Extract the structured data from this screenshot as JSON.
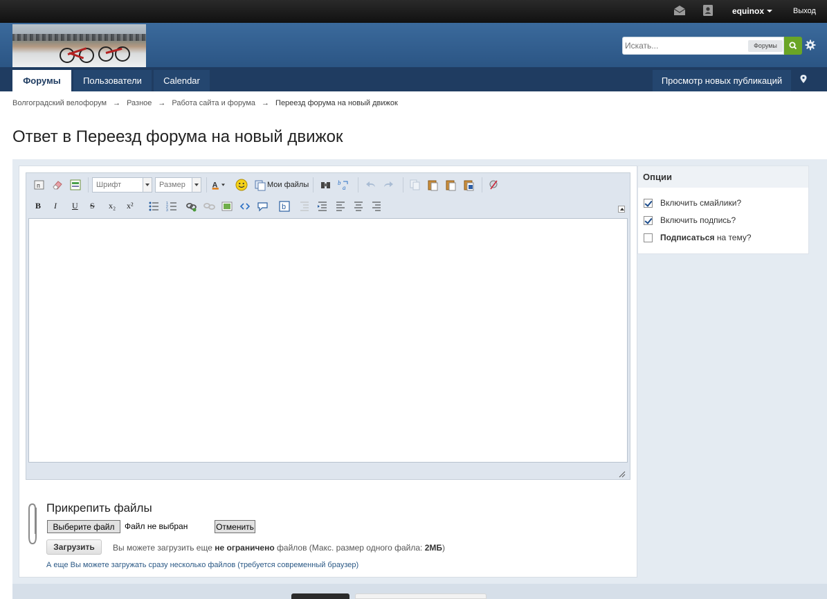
{
  "userbar": {
    "username": "equinox",
    "logout": "Выход",
    "icons": [
      "envelope-icon",
      "user-card-icon",
      "chevron-down-icon"
    ]
  },
  "header": {
    "search_placeholder": "Искать...",
    "search_scope": "Форумы",
    "icons": [
      "search-icon",
      "gear-icon"
    ]
  },
  "nav": {
    "tabs": [
      {
        "label": "Форумы",
        "active": true
      },
      {
        "label": "Пользователи",
        "active": false
      },
      {
        "label": "Calendar",
        "active": false
      }
    ],
    "new_posts": "Просмотр новых публикаций",
    "icons": [
      "map-pin-icon"
    ]
  },
  "breadcrumb": {
    "items": [
      "Волгоградский велофорум",
      "Разное",
      "Работа сайта и форума",
      "Переезд форума на новый движок"
    ],
    "separator": "→"
  },
  "page_title": "Ответ в Переезд форума на новый движок",
  "editor": {
    "font_combo": "Шрифт",
    "size_combo": "Размер",
    "my_files": "Мои файлы",
    "format_bold": "B",
    "format_italic": "I",
    "format_underline": "U",
    "format_strike": "S",
    "format_sub": "x₂",
    "format_sup": "x²"
  },
  "attach": {
    "title": "Прикрепить файлы",
    "choose_button": "Выберите файл",
    "no_file": "Файл не выбран",
    "cancel_button": "Отменить",
    "upload_button": "Загрузить",
    "info_prefix": "Вы можете загрузить еще",
    "info_bold": "не ограничено",
    "info_middle": "файлов (Макс. размер одного файла:",
    "info_size": "2МБ",
    "info_suffix": ")",
    "multi_link": "А еще Вы можете загружать сразу несколько файлов (требуется современный браузер)"
  },
  "options": {
    "title": "Опции",
    "items": [
      {
        "label": "Включить смайлики?",
        "checked": true
      },
      {
        "label": "Включить подпись?",
        "checked": true
      },
      {
        "label_bold": "Подписаться",
        "label_rest": "на тему?",
        "checked": false
      }
    ]
  },
  "colors": {
    "header_blue": "#2b5584",
    "nav_dark": "#1f3c61",
    "search_green": "#6aa526",
    "form_bg": "#e4ebf2"
  }
}
